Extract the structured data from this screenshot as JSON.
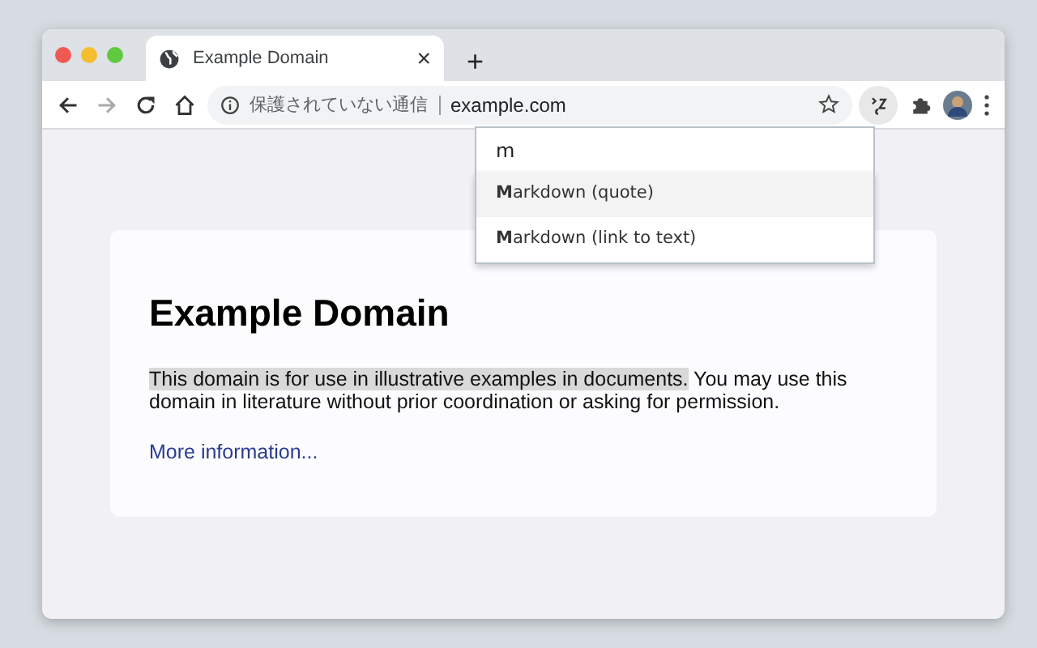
{
  "tab": {
    "title": "Example Domain",
    "close": "×"
  },
  "new_tab": "+",
  "omnibox": {
    "security": "保護されていない通信",
    "url": "example.com"
  },
  "popup": {
    "query": "m",
    "items": [
      {
        "label": "**M**arkdown (quote)",
        "selected": true
      },
      {
        "label": "**M**arkdown (link to text)",
        "selected": false
      }
    ]
  },
  "page": {
    "heading": "Example Domain",
    "paragraph": [
      {
        "text": "This domain is for use in illustrative examples in documents.",
        "selected": true
      },
      {
        "text": " You may use this domain in literature without prior coordination or asking for permission.",
        "selected": false
      }
    ],
    "link": "More information..."
  }
}
